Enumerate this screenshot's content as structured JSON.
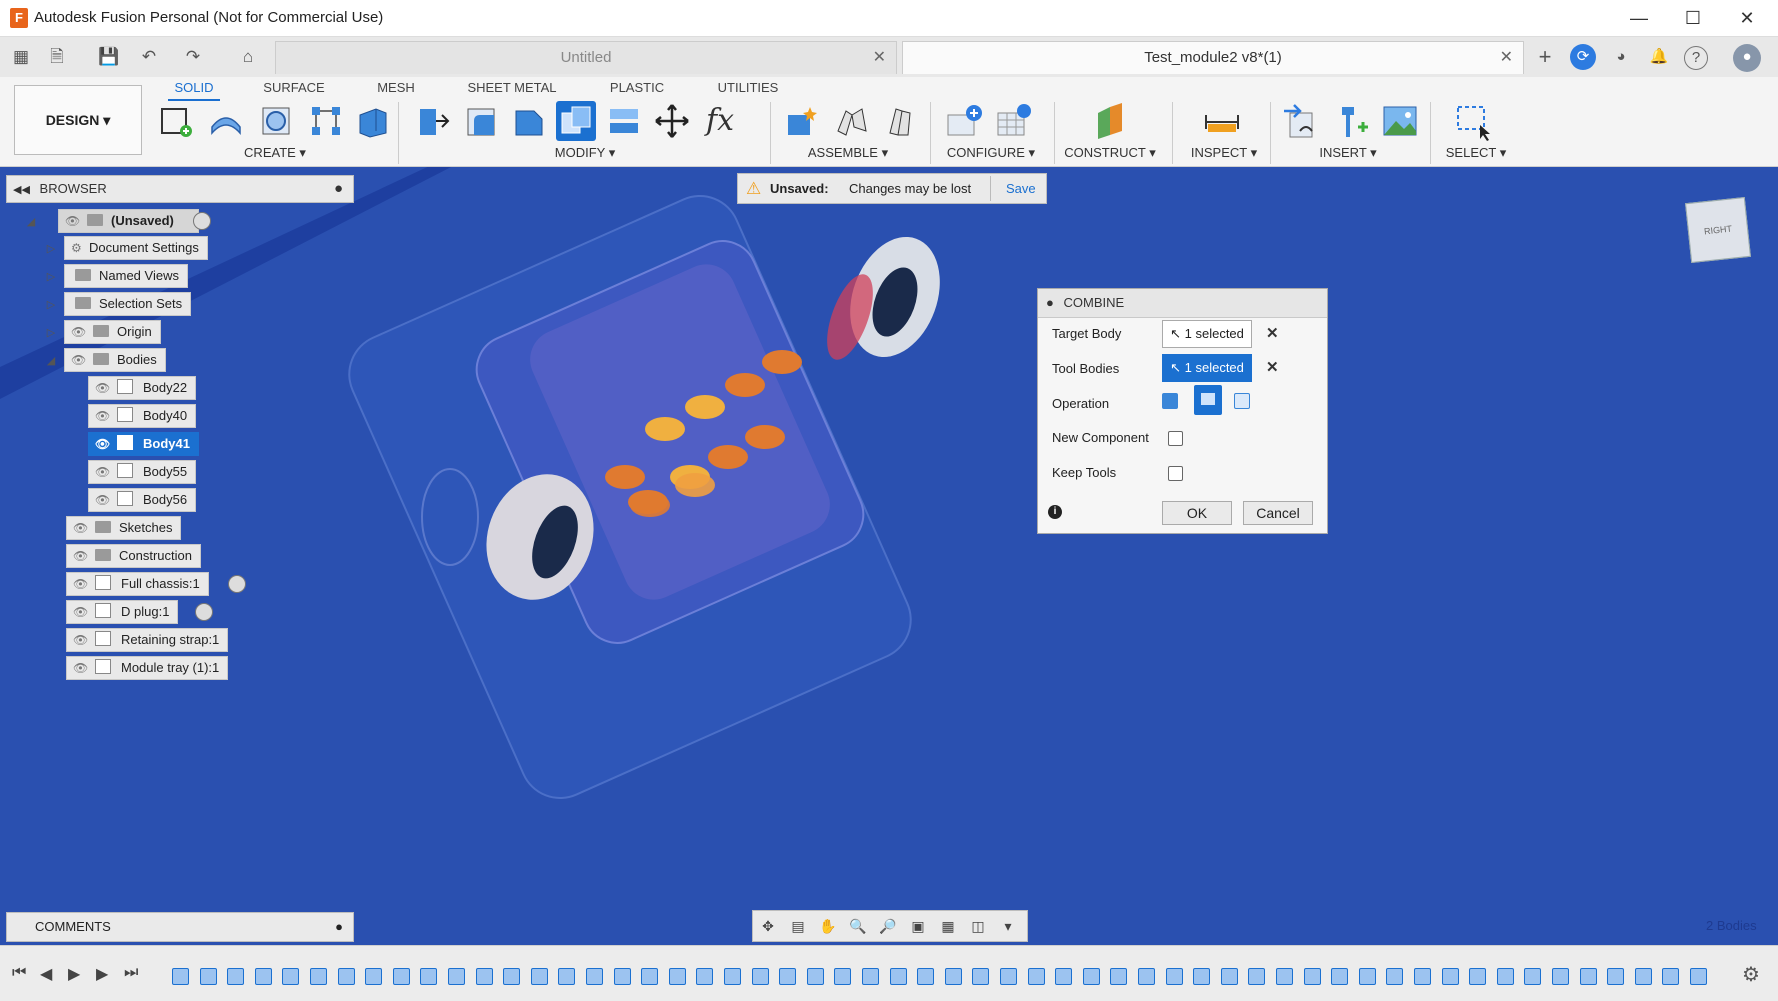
{
  "window": {
    "title": "Autodesk Fusion Personal (Not for Commercial Use)"
  },
  "tabs": [
    {
      "label": "Untitled"
    },
    {
      "label": "Test_module2 v8*(1)"
    }
  ],
  "toolbar": {
    "workspace_button": "DESIGN",
    "workspace_tabs": [
      "SOLID",
      "SURFACE",
      "MESH",
      "SHEET METAL",
      "PLASTIC",
      "UTILITIES"
    ],
    "groups": [
      "CREATE",
      "MODIFY",
      "ASSEMBLE",
      "CONFIGURE",
      "CONSTRUCT",
      "INSPECT",
      "INSERT",
      "SELECT"
    ]
  },
  "browser": {
    "title": "BROWSER",
    "root": "(Unsaved)",
    "nodes": [
      "Document Settings",
      "Named Views",
      "Selection Sets",
      "Origin",
      "Bodies"
    ],
    "bodies": [
      "Body22",
      "Body40",
      "Body41",
      "Body55",
      "Body56"
    ],
    "components": [
      "Sketches",
      "Construction",
      "Full chassis:1",
      "D plug:1",
      "Retaining strap:1",
      "Module tray (1):1"
    ]
  },
  "unsaved_bar": {
    "label": "Unsaved:",
    "message": "Changes may be lost",
    "save_label": "Save"
  },
  "combine": {
    "title": "COMBINE",
    "target_label": "Target Body",
    "target_value": "1 selected",
    "tool_label": "Tool Bodies",
    "tool_value": "1 selected",
    "operation_label": "Operation",
    "new_component_label": "New Component",
    "keep_tools_label": "Keep Tools",
    "ok_label": "OK",
    "cancel_label": "Cancel"
  },
  "comments": {
    "label": "COMMENTS"
  },
  "status": {
    "bodies_count": "2 Bodies"
  },
  "colors": {
    "accent": "#1b70d0",
    "viewport": "#2a50b0",
    "warning": "#f0a020"
  }
}
